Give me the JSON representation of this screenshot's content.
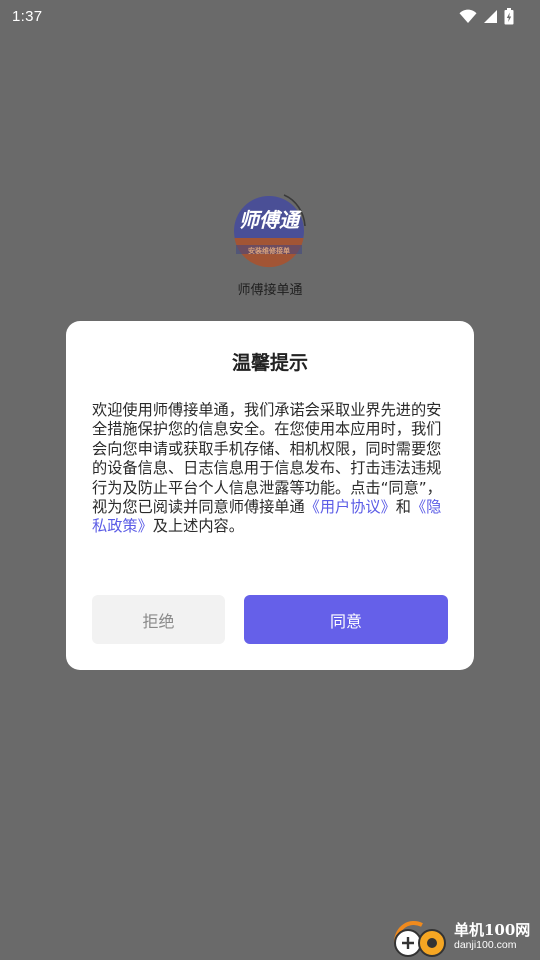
{
  "status_bar": {
    "time": "1:37",
    "icons": [
      "wifi-icon",
      "signal-icon",
      "battery-charging-icon"
    ]
  },
  "app": {
    "logo_text": "师傅通",
    "logo_subtext": "安装维修接单",
    "name": "师傅接单通"
  },
  "dialog": {
    "title": "温馨提示",
    "body_prefix": "欢迎使用师傅接单通，我们承诺会采取业界先进的安全措施保护您的信息安全。在您使用本应用时，我们会向您申请或获取手机存储、相机权限，同时需要您的设备信息、日志信息用于信息发布、打击违法违规行为及防止平台个人信息泄露等功能。点击“同意”，视为您已阅读并同意师傅接单通",
    "user_agreement_link": "《用户协议》",
    "conjunction": "和",
    "privacy_policy_link": "《隐私政策》",
    "body_suffix": "及上述内容。",
    "reject_label": "拒绝",
    "agree_label": "同意"
  },
  "watermark": {
    "cn": "单机100网",
    "en": "danji100.com"
  },
  "colors": {
    "overlay": "#6a6a6a",
    "accent": "#6560e9",
    "link": "#5b5ce6",
    "reject_bg": "#f2f2f2"
  }
}
